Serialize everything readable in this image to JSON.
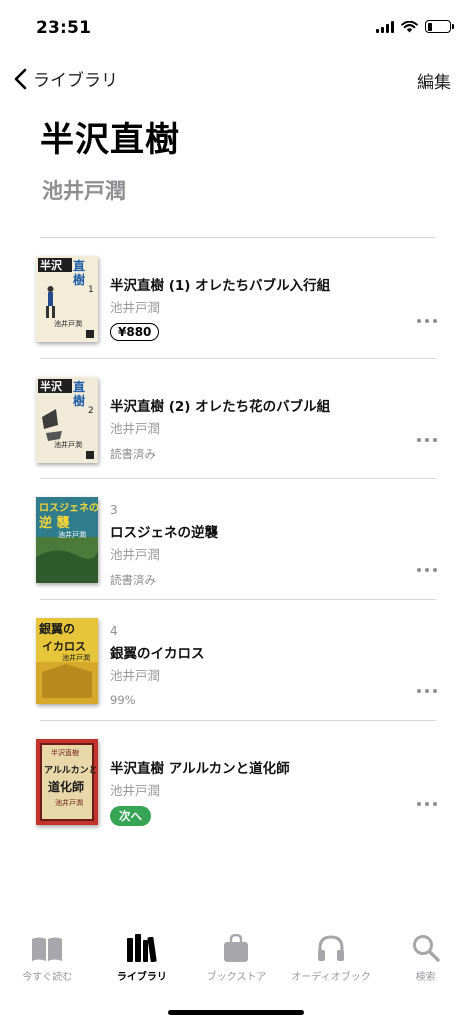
{
  "status_bar": {
    "time": "23:51"
  },
  "nav": {
    "back_label": "ライブラリ",
    "edit_label": "編集"
  },
  "header": {
    "title": "半沢直樹",
    "subtitle": "池井戸潤"
  },
  "books": [
    {
      "number": "",
      "title": "半沢直樹 (1) オレたちバブル入行組",
      "author": "池井戸潤",
      "price": "¥880",
      "status": "",
      "badge": ""
    },
    {
      "number": "",
      "title": "半沢直樹 (2) オレたち花のバブル組",
      "author": "池井戸潤",
      "price": "",
      "status": "読書済み",
      "badge": ""
    },
    {
      "number": "3",
      "title": "ロスジェネの逆襲",
      "author": "池井戸潤",
      "price": "",
      "status": "読書済み",
      "badge": ""
    },
    {
      "number": "4",
      "title": "銀翼のイカロス",
      "author": "池井戸潤",
      "price": "",
      "status": "99%",
      "badge": ""
    },
    {
      "number": "",
      "title": "半沢直樹 アルルカンと道化師",
      "author": "池井戸潤",
      "price": "",
      "status": "",
      "badge": "次へ"
    }
  ],
  "covers": [
    {
      "title_text": "半沢直樹1",
      "author_text": "池井戸潤",
      "background": "#f3ecd9"
    },
    {
      "title_text": "半沢直樹2",
      "author_text": "池井戸潤",
      "background": "#f1ead8"
    },
    {
      "title_text": "ロスジェネの逆襲",
      "author_text": "池井戸潤",
      "background": "#2f7d8c"
    },
    {
      "title_text": "銀翼のイカロス",
      "author_text": "池井戸潤",
      "background": "#e7c53a"
    },
    {
      "title_text": "アルルカンと道化師",
      "author_text": "池井戸潤",
      "background": "#c4342c"
    }
  ],
  "tabs": [
    {
      "label": "今すぐ読む",
      "icon": "book-open-icon"
    },
    {
      "label": "ライブラリ",
      "icon": "library-icon"
    },
    {
      "label": "ブックストア",
      "icon": "bag-icon"
    },
    {
      "label": "オーディオブック",
      "icon": "headphones-icon"
    },
    {
      "label": "検索",
      "icon": "search-icon"
    }
  ],
  "colors": {
    "accent_green": "#37a456",
    "secondary_text": "#8e8e93",
    "active_tab": "#000000"
  }
}
